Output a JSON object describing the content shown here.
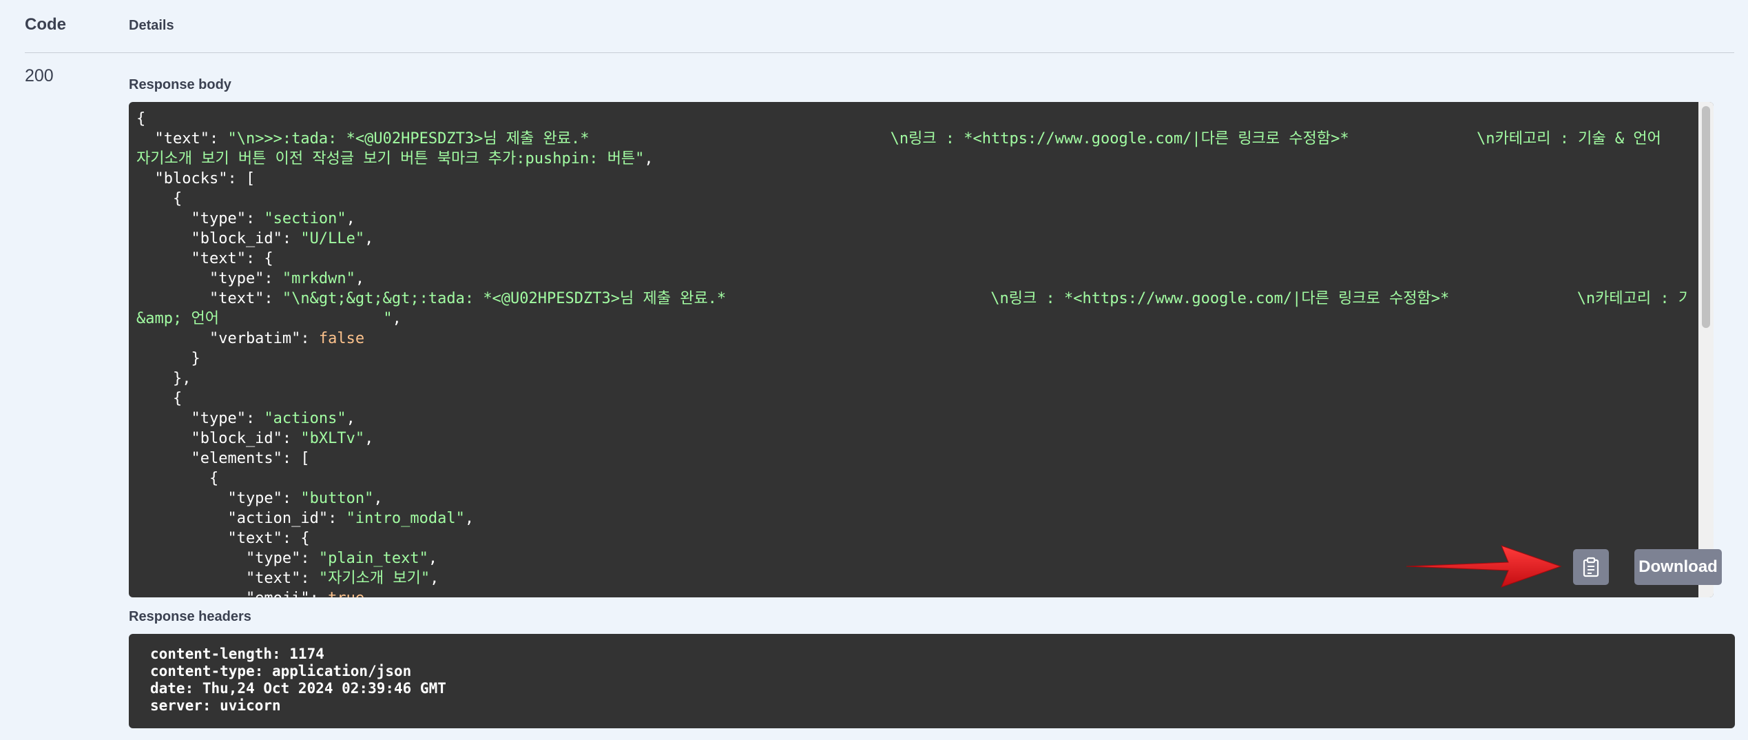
{
  "table": {
    "code_header": "Code",
    "details_header": "Details",
    "status_code": "200"
  },
  "response_body": {
    "label": "Response body",
    "lines": [
      [
        {
          "t": "{",
          "c": "k"
        }
      ],
      [
        {
          "t": "  \"text\": ",
          "c": "k"
        },
        {
          "t": "\"\\n>>>:tada: *<@U02HPESDZT3>님 제출 완료.*                                 \\n링크 : *<https://www.google.com/|다른 링크로 수정함>*              \\n카테고리 : 기술 & 언어",
          "c": "s"
        }
      ],
      [
        {
          "t": "자기소개 보기 버튼 이전 작성글 보기 버튼 북마크 추가:pushpin: 버튼\"",
          "c": "s"
        },
        {
          "t": ",",
          "c": "k"
        }
      ],
      [
        {
          "t": "  \"blocks\": [",
          "c": "k"
        }
      ],
      [
        {
          "t": "    {",
          "c": "k"
        }
      ],
      [
        {
          "t": "      \"type\": ",
          "c": "k"
        },
        {
          "t": "\"section\"",
          "c": "s"
        },
        {
          "t": ",",
          "c": "k"
        }
      ],
      [
        {
          "t": "      \"block_id\": ",
          "c": "k"
        },
        {
          "t": "\"U/LLe\"",
          "c": "s"
        },
        {
          "t": ",",
          "c": "k"
        }
      ],
      [
        {
          "t": "      \"text\": {",
          "c": "k"
        }
      ],
      [
        {
          "t": "        \"type\": ",
          "c": "k"
        },
        {
          "t": "\"mrkdwn\"",
          "c": "s"
        },
        {
          "t": ",",
          "c": "k"
        }
      ],
      [
        {
          "t": "        \"text\": ",
          "c": "k"
        },
        {
          "t": "\"\\n&gt;&gt;&gt;:tada: *<@U02HPESDZT3>님 제출 완료.*                             \\n링크 : *<https://www.google.com/|다른 링크로 수정함>*              \\n카테고리 : 기술",
          "c": "s"
        }
      ],
      [
        {
          "t": "&amp; 언어                  \"",
          "c": "s"
        },
        {
          "t": ",",
          "c": "k"
        }
      ],
      [
        {
          "t": "        \"verbatim\": ",
          "c": "k"
        },
        {
          "t": "false",
          "c": "b"
        }
      ],
      [
        {
          "t": "      }",
          "c": "k"
        }
      ],
      [
        {
          "t": "    },",
          "c": "k"
        }
      ],
      [
        {
          "t": "    {",
          "c": "k"
        }
      ],
      [
        {
          "t": "      \"type\": ",
          "c": "k"
        },
        {
          "t": "\"actions\"",
          "c": "s"
        },
        {
          "t": ",",
          "c": "k"
        }
      ],
      [
        {
          "t": "      \"block_id\": ",
          "c": "k"
        },
        {
          "t": "\"bXLTv\"",
          "c": "s"
        },
        {
          "t": ",",
          "c": "k"
        }
      ],
      [
        {
          "t": "      \"elements\": [",
          "c": "k"
        }
      ],
      [
        {
          "t": "        {",
          "c": "k"
        }
      ],
      [
        {
          "t": "          \"type\": ",
          "c": "k"
        },
        {
          "t": "\"button\"",
          "c": "s"
        },
        {
          "t": ",",
          "c": "k"
        }
      ],
      [
        {
          "t": "          \"action_id\": ",
          "c": "k"
        },
        {
          "t": "\"intro_modal\"",
          "c": "s"
        },
        {
          "t": ",",
          "c": "k"
        }
      ],
      [
        {
          "t": "          \"text\": {",
          "c": "k"
        }
      ],
      [
        {
          "t": "            \"type\": ",
          "c": "k"
        },
        {
          "t": "\"plain_text\"",
          "c": "s"
        },
        {
          "t": ",",
          "c": "k"
        }
      ],
      [
        {
          "t": "            \"text\": ",
          "c": "k"
        },
        {
          "t": "\"자기소개 보기\"",
          "c": "s"
        },
        {
          "t": ",",
          "c": "k"
        }
      ],
      [
        {
          "t": "            \"emoji\": ",
          "c": "k"
        },
        {
          "t": "true",
          "c": "b"
        }
      ]
    ],
    "copy_icon": "clipboard-icon",
    "download_label": "Download"
  },
  "response_headers": {
    "label": "Response headers",
    "lines": [
      "content-length: 1174",
      "content-type: application/json",
      "date: Thu,24 Oct 2024 02:39:46 GMT",
      "server: uvicorn"
    ]
  },
  "colors": {
    "page_bg": "#eef4fb",
    "code_bg": "#333333",
    "string": "#a2fca2",
    "boolean": "#fcc28c",
    "button_bg": "#7d8293",
    "arrow": "#e8141a"
  }
}
